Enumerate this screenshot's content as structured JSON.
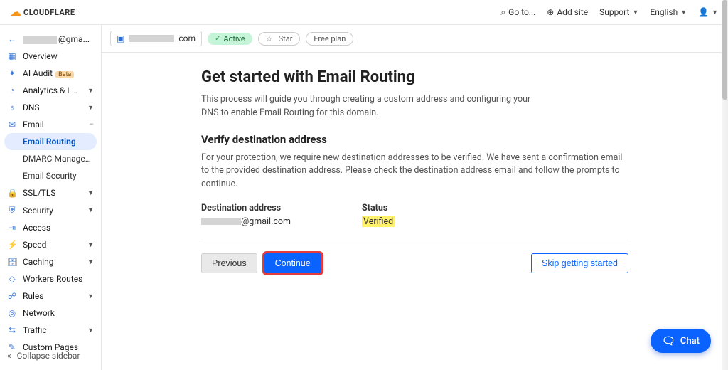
{
  "brand": {
    "name": "CLOUDFLARE"
  },
  "topbar": {
    "goto": "Go to...",
    "add_site": "Add site",
    "support": "Support",
    "language": "English"
  },
  "sidebar": {
    "back_suffix": "@gma...",
    "items": {
      "overview": "Overview",
      "ai_audit": "AI Audit",
      "analytics": "Analytics & Logs",
      "dns": "DNS",
      "email": "Email",
      "email_routing": "Email Routing",
      "dmarc": "DMARC Management",
      "email_security": "Email Security",
      "ssl": "SSL/TLS",
      "security": "Security",
      "access": "Access",
      "speed": "Speed",
      "caching": "Caching",
      "workers": "Workers Routes",
      "rules": "Rules",
      "network": "Network",
      "traffic": "Traffic",
      "custom_pages": "Custom Pages"
    },
    "beta": "Beta",
    "collapse": "Collapse sidebar"
  },
  "sitebar": {
    "domain_suffix": "com",
    "active": "Active",
    "star": "Star",
    "free": "Free plan"
  },
  "page": {
    "title": "Get started with Email Routing",
    "desc": "This process will guide you through creating a custom address and configuring your DNS to enable Email Routing for this domain.",
    "section_title": "Verify destination address",
    "section_desc": "For your protection, we require new destination addresses to be verified. We have sent a confirmation email to the provided destination address. Please check the destination address email and follow the prompts to continue.",
    "dest_label": "Destination address",
    "dest_value_suffix": "@gmail.com",
    "status_label": "Status",
    "status_value": "Verified",
    "btn_prev": "Previous",
    "btn_continue": "Continue",
    "btn_skip": "Skip getting started"
  },
  "chat": {
    "label": "Chat"
  }
}
